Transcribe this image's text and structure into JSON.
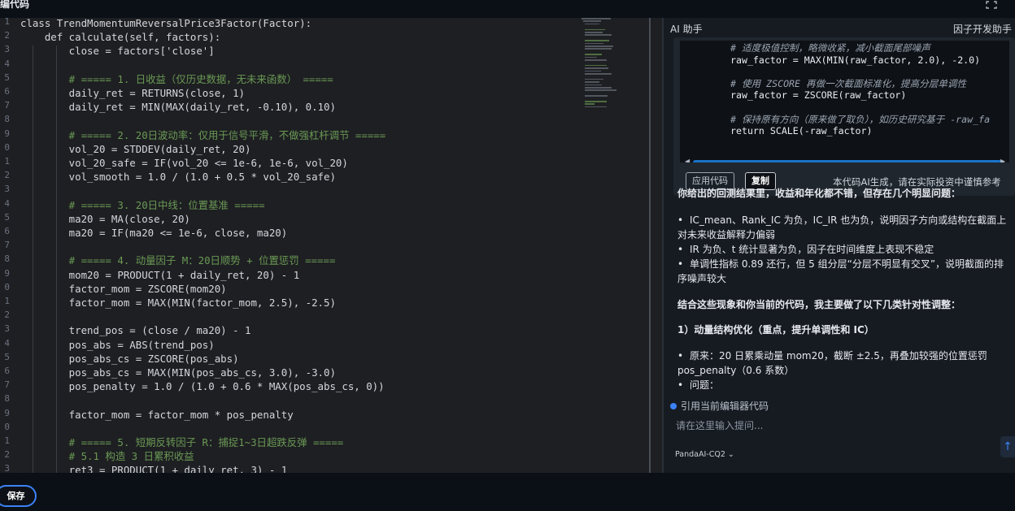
{
  "app": {
    "title": "编代码",
    "fullscreen_icon": "fullscreen-icon"
  },
  "editor": {
    "line_numbers": [
      "1",
      "2",
      "3",
      "4",
      "5",
      "6",
      "7",
      "8",
      "9",
      "0",
      "1",
      "2",
      "3",
      "4",
      "5",
      "6",
      "7",
      "8",
      "9",
      "0",
      "1",
      "2",
      "3",
      "4",
      "5",
      "6",
      "7",
      "8",
      "9",
      "0",
      "1",
      "2",
      "3"
    ],
    "lines": [
      {
        "text": "class TrendMomentumReversalPrice3Factor(Factor):",
        "color": "#d4d7dd"
      },
      {
        "text": "    def calculate(self, factors):",
        "color": "#d4d7dd"
      },
      {
        "text": "        close = factors['close']",
        "color": "#d4d7dd"
      },
      {
        "text": "",
        "color": "#d4d7dd"
      },
      {
        "text": "        # ===== 1. 日收益（仅历史数据，无未来函数） =====",
        "color": "#6a9955"
      },
      {
        "text": "        daily_ret = RETURNS(close, 1)",
        "color": "#d4d7dd"
      },
      {
        "text": "        daily_ret = MIN(MAX(daily_ret, -0.10), 0.10)",
        "color": "#d4d7dd"
      },
      {
        "text": "",
        "color": "#d4d7dd"
      },
      {
        "text": "        # ===== 2. 20日波动率：仅用于信号平滑，不做强杠杆调节 =====",
        "color": "#6a9955"
      },
      {
        "text": "        vol_20 = STDDEV(daily_ret, 20)",
        "color": "#d4d7dd"
      },
      {
        "text": "        vol_20_safe = IF(vol_20 <= 1e-6, 1e-6, vol_20)",
        "color": "#d4d7dd"
      },
      {
        "text": "        vol_smooth = 1.0 / (1.0 + 0.5 * vol_20_safe)",
        "color": "#d4d7dd"
      },
      {
        "text": "",
        "color": "#d4d7dd"
      },
      {
        "text": "        # ===== 3. 20日中线：位置基准 =====",
        "color": "#6a9955"
      },
      {
        "text": "        ma20 = MA(close, 20)",
        "color": "#d4d7dd"
      },
      {
        "text": "        ma20 = IF(ma20 <= 1e-6, close, ma20)",
        "color": "#d4d7dd"
      },
      {
        "text": "",
        "color": "#d4d7dd"
      },
      {
        "text": "        # ===== 4. 动量因子 M：20日顺势 + 位置惩罚 =====",
        "color": "#6a9955"
      },
      {
        "text": "        mom20 = PRODUCT(1 + daily_ret, 20) - 1",
        "color": "#d4d7dd"
      },
      {
        "text": "        factor_mom = ZSCORE(mom20)",
        "color": "#d4d7dd"
      },
      {
        "text": "        factor_mom = MAX(MIN(factor_mom, 2.5), -2.5)",
        "color": "#d4d7dd"
      },
      {
        "text": "",
        "color": "#d4d7dd"
      },
      {
        "text": "        trend_pos = (close / ma20) - 1",
        "color": "#d4d7dd"
      },
      {
        "text": "        pos_abs = ABS(trend_pos)",
        "color": "#d4d7dd"
      },
      {
        "text": "        pos_abs_cs = ZSCORE(pos_abs)",
        "color": "#d4d7dd"
      },
      {
        "text": "        pos_abs_cs = MAX(MIN(pos_abs_cs, 3.0), -3.0)",
        "color": "#d4d7dd"
      },
      {
        "text": "        pos_penalty = 1.0 / (1.0 + 0.6 * MAX(pos_abs_cs, 0))",
        "color": "#d4d7dd"
      },
      {
        "text": "",
        "color": "#d4d7dd"
      },
      {
        "text": "        factor_mom = factor_mom * pos_penalty",
        "color": "#d4d7dd"
      },
      {
        "text": "",
        "color": "#d4d7dd"
      },
      {
        "text": "        # ===== 5. 短期反转因子 R：捕捉1~3日超跌反弹 =====",
        "color": "#6a9955"
      },
      {
        "text": "        # 5.1 构造 3 日累积收益",
        "color": "#6a9955"
      },
      {
        "text": "        ret3 = PRODUCT(1 + daily_ret, 3) - 1",
        "color": "#d4d7dd"
      }
    ]
  },
  "ai_panel": {
    "title": "AI 助手",
    "subtitle": "因子开发助手",
    "code_card": {
      "lines": [
        {
          "text": "# 适度极值控制，略微收紧，减小截面尾部噪声",
          "comment": true
        },
        {
          "text": "raw_factor = MAX(MIN(raw_factor, 2.0), -2.0)",
          "comment": false
        },
        {
          "text": "",
          "comment": false
        },
        {
          "text": "# 使用 ZSCORE 再做一次截面标准化，提高分层单调性",
          "comment": true
        },
        {
          "text": "raw_factor = ZSCORE(raw_factor)",
          "comment": false
        },
        {
          "text": "",
          "comment": false
        },
        {
          "text": "# 保持原有方向（原来做了取负），如历史研究基于 -raw_fa",
          "comment": true
        },
        {
          "text": "return SCALE(-raw_factor)",
          "comment": false
        }
      ],
      "apply_button": "应用代码",
      "copy_button": "复制",
      "disclaimer": "本代码AI生成，请在实际投资中谨慎参考"
    },
    "message": {
      "intro": "你给出的回测结果里，收益和年化都不错，但存在几个明显问题：",
      "bullets": [
        "IC_mean、Rank_IC 为负，IC_IR 也为负，说明因子方向或结构在截面上对未来收益解释力偏弱",
        "IR 为负、t 统计显著为负，因子在时间维度上表现不稳定",
        "单调性指标 0.89 还行，但 5 组分层“分层不明显有交叉”，说明截面的排序噪声较大"
      ],
      "adjust": "结合这些现象和你当前的代码，我主要做了以下几类针对性调整：",
      "section": "1）动量结构优化（重点，提升单调性和 IC）",
      "sub_bullets": [
        "原来：20 日累乘动量 mom20，截断 ±2.5，再叠加较强的位置惩罚 pos_penalty（0.6 系数）",
        "问题："
      ]
    },
    "cite_label": "引用当前编辑器代码",
    "prompt_placeholder": "请在这里输入提问...",
    "model": "PandaAI-CQ2 ⌄",
    "send_icon": "send-icon"
  },
  "footer": {
    "save_button": "保存"
  }
}
